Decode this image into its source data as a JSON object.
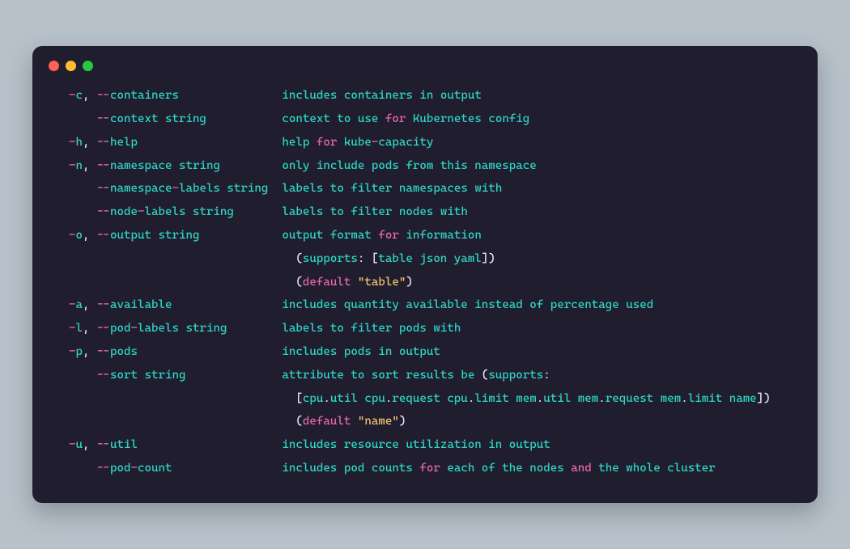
{
  "colors": {
    "bg_page": "#b7c1ca",
    "bg_terminal": "#1f1d2e",
    "token_teal": "#2fd6c4",
    "token_white": "#e6e3f3",
    "token_pink": "#e867a8",
    "token_yellow": "#f0c36d"
  },
  "traffic_lights": [
    "close",
    "minimize",
    "zoom"
  ],
  "lines": [
    [
      {
        "c": "teal",
        "t": "  "
      },
      {
        "c": "pink",
        "t": "-"
      },
      {
        "c": "teal",
        "t": "c"
      },
      {
        "c": "white",
        "t": ", "
      },
      {
        "c": "pink",
        "t": "--"
      },
      {
        "c": "teal",
        "t": "containers"
      },
      {
        "c": "teal",
        "t": "               includes"
      },
      {
        "c": "teal",
        "t": " containers"
      },
      {
        "c": "teal",
        "t": " in"
      },
      {
        "c": "teal",
        "t": " output"
      }
    ],
    [
      {
        "c": "teal",
        "t": "      "
      },
      {
        "c": "pink",
        "t": "--"
      },
      {
        "c": "teal",
        "t": "context string"
      },
      {
        "c": "teal",
        "t": "           context"
      },
      {
        "c": "teal",
        "t": " to"
      },
      {
        "c": "teal",
        "t": " use "
      },
      {
        "c": "pink",
        "t": "for"
      },
      {
        "c": "teal",
        "t": " Kubernetes"
      },
      {
        "c": "teal",
        "t": " config"
      }
    ],
    [
      {
        "c": "teal",
        "t": "  "
      },
      {
        "c": "pink",
        "t": "-"
      },
      {
        "c": "teal",
        "t": "h"
      },
      {
        "c": "white",
        "t": ", "
      },
      {
        "c": "pink",
        "t": "--"
      },
      {
        "c": "teal",
        "t": "help"
      },
      {
        "c": "teal",
        "t": "                     help "
      },
      {
        "c": "pink",
        "t": "for"
      },
      {
        "c": "teal",
        "t": " kube"
      },
      {
        "c": "pink",
        "t": "-"
      },
      {
        "c": "teal",
        "t": "capacity"
      }
    ],
    [
      {
        "c": "teal",
        "t": "  "
      },
      {
        "c": "pink",
        "t": "-"
      },
      {
        "c": "teal",
        "t": "n"
      },
      {
        "c": "white",
        "t": ", "
      },
      {
        "c": "pink",
        "t": "--"
      },
      {
        "c": "teal",
        "t": "namespace string"
      },
      {
        "c": "teal",
        "t": "         only"
      },
      {
        "c": "teal",
        "t": " include"
      },
      {
        "c": "teal",
        "t": " pods"
      },
      {
        "c": "teal",
        "t": " from"
      },
      {
        "c": "teal",
        "t": " this"
      },
      {
        "c": "teal",
        "t": " namespace"
      }
    ],
    [
      {
        "c": "teal",
        "t": "      "
      },
      {
        "c": "pink",
        "t": "--"
      },
      {
        "c": "teal",
        "t": "namespace"
      },
      {
        "c": "pink",
        "t": "-"
      },
      {
        "c": "teal",
        "t": "labels string"
      },
      {
        "c": "teal",
        "t": "  labels"
      },
      {
        "c": "teal",
        "t": " to"
      },
      {
        "c": "teal",
        "t": " filter"
      },
      {
        "c": "teal",
        "t": " namespaces"
      },
      {
        "c": "teal",
        "t": " with"
      }
    ],
    [
      {
        "c": "teal",
        "t": "      "
      },
      {
        "c": "pink",
        "t": "--"
      },
      {
        "c": "teal",
        "t": "node"
      },
      {
        "c": "pink",
        "t": "-"
      },
      {
        "c": "teal",
        "t": "labels string"
      },
      {
        "c": "teal",
        "t": "       labels"
      },
      {
        "c": "teal",
        "t": " to"
      },
      {
        "c": "teal",
        "t": " filter"
      },
      {
        "c": "teal",
        "t": " nodes"
      },
      {
        "c": "teal",
        "t": " with"
      }
    ],
    [
      {
        "c": "teal",
        "t": "  "
      },
      {
        "c": "pink",
        "t": "-"
      },
      {
        "c": "teal",
        "t": "o"
      },
      {
        "c": "white",
        "t": ", "
      },
      {
        "c": "pink",
        "t": "--"
      },
      {
        "c": "teal",
        "t": "output string"
      },
      {
        "c": "teal",
        "t": "            output"
      },
      {
        "c": "teal",
        "t": " format "
      },
      {
        "c": "pink",
        "t": "for"
      },
      {
        "c": "teal",
        "t": " information"
      }
    ],
    [
      {
        "c": "teal",
        "t": "                                   "
      },
      {
        "c": "white",
        "t": "("
      },
      {
        "c": "teal",
        "t": "supports"
      },
      {
        "c": "white",
        "t": ": ["
      },
      {
        "c": "teal",
        "t": "table json yaml"
      },
      {
        "c": "white",
        "t": "])"
      }
    ],
    [
      {
        "c": "teal",
        "t": "                                   "
      },
      {
        "c": "white",
        "t": "("
      },
      {
        "c": "pink",
        "t": "default"
      },
      {
        "c": "teal",
        "t": " "
      },
      {
        "c": "yellow",
        "t": "\"table\""
      },
      {
        "c": "white",
        "t": ")"
      }
    ],
    [
      {
        "c": "teal",
        "t": "  "
      },
      {
        "c": "pink",
        "t": "-"
      },
      {
        "c": "teal",
        "t": "a"
      },
      {
        "c": "white",
        "t": ", "
      },
      {
        "c": "pink",
        "t": "--"
      },
      {
        "c": "teal",
        "t": "available"
      },
      {
        "c": "teal",
        "t": "                includes"
      },
      {
        "c": "teal",
        "t": " quantity"
      },
      {
        "c": "teal",
        "t": " available"
      },
      {
        "c": "teal",
        "t": " instead"
      },
      {
        "c": "teal",
        "t": " of"
      },
      {
        "c": "teal",
        "t": " percentage"
      },
      {
        "c": "teal",
        "t": " used"
      }
    ],
    [
      {
        "c": "teal",
        "t": "  "
      },
      {
        "c": "pink",
        "t": "-"
      },
      {
        "c": "teal",
        "t": "l"
      },
      {
        "c": "white",
        "t": ", "
      },
      {
        "c": "pink",
        "t": "--"
      },
      {
        "c": "teal",
        "t": "pod"
      },
      {
        "c": "pink",
        "t": "-"
      },
      {
        "c": "teal",
        "t": "labels string"
      },
      {
        "c": "teal",
        "t": "        labels"
      },
      {
        "c": "teal",
        "t": " to"
      },
      {
        "c": "teal",
        "t": " filter"
      },
      {
        "c": "teal",
        "t": " pods"
      },
      {
        "c": "teal",
        "t": " with"
      }
    ],
    [
      {
        "c": "teal",
        "t": "  "
      },
      {
        "c": "pink",
        "t": "-"
      },
      {
        "c": "teal",
        "t": "p"
      },
      {
        "c": "white",
        "t": ", "
      },
      {
        "c": "pink",
        "t": "--"
      },
      {
        "c": "teal",
        "t": "pods"
      },
      {
        "c": "teal",
        "t": "                     includes"
      },
      {
        "c": "teal",
        "t": " pods"
      },
      {
        "c": "teal",
        "t": " in"
      },
      {
        "c": "teal",
        "t": " output"
      }
    ],
    [
      {
        "c": "teal",
        "t": "      "
      },
      {
        "c": "pink",
        "t": "--"
      },
      {
        "c": "teal",
        "t": "sort string"
      },
      {
        "c": "teal",
        "t": "              attribute"
      },
      {
        "c": "teal",
        "t": " to"
      },
      {
        "c": "teal",
        "t": " sort"
      },
      {
        "c": "teal",
        "t": " results"
      },
      {
        "c": "teal",
        "t": " be "
      },
      {
        "c": "white",
        "t": "("
      },
      {
        "c": "teal",
        "t": "supports"
      },
      {
        "c": "white",
        "t": ":"
      }
    ],
    [
      {
        "c": "teal",
        "t": "                                   "
      },
      {
        "c": "white",
        "t": "["
      },
      {
        "c": "teal",
        "t": "cpu"
      },
      {
        "c": "white",
        "t": "."
      },
      {
        "c": "teal",
        "t": "util cpu"
      },
      {
        "c": "white",
        "t": "."
      },
      {
        "c": "teal",
        "t": "request cpu"
      },
      {
        "c": "white",
        "t": "."
      },
      {
        "c": "teal",
        "t": "limit mem"
      },
      {
        "c": "white",
        "t": "."
      },
      {
        "c": "teal",
        "t": "util mem"
      },
      {
        "c": "white",
        "t": "."
      },
      {
        "c": "teal",
        "t": "request mem"
      },
      {
        "c": "white",
        "t": "."
      },
      {
        "c": "teal",
        "t": "limit name"
      },
      {
        "c": "white",
        "t": "])"
      }
    ],
    [
      {
        "c": "teal",
        "t": "                                   "
      },
      {
        "c": "white",
        "t": "("
      },
      {
        "c": "pink",
        "t": "default"
      },
      {
        "c": "teal",
        "t": " "
      },
      {
        "c": "yellow",
        "t": "\"name\""
      },
      {
        "c": "white",
        "t": ")"
      }
    ],
    [
      {
        "c": "teal",
        "t": "  "
      },
      {
        "c": "pink",
        "t": "-"
      },
      {
        "c": "teal",
        "t": "u"
      },
      {
        "c": "white",
        "t": ", "
      },
      {
        "c": "pink",
        "t": "--"
      },
      {
        "c": "teal",
        "t": "util"
      },
      {
        "c": "teal",
        "t": "                     includes"
      },
      {
        "c": "teal",
        "t": " resource"
      },
      {
        "c": "teal",
        "t": " utilization"
      },
      {
        "c": "teal",
        "t": " in"
      },
      {
        "c": "teal",
        "t": " output"
      }
    ],
    [
      {
        "c": "teal",
        "t": "      "
      },
      {
        "c": "pink",
        "t": "--"
      },
      {
        "c": "teal",
        "t": "pod"
      },
      {
        "c": "pink",
        "t": "-"
      },
      {
        "c": "teal",
        "t": "count"
      },
      {
        "c": "teal",
        "t": "                includes"
      },
      {
        "c": "teal",
        "t": " pod"
      },
      {
        "c": "teal",
        "t": " counts "
      },
      {
        "c": "pink",
        "t": "for"
      },
      {
        "c": "teal",
        "t": " each"
      },
      {
        "c": "teal",
        "t": " of"
      },
      {
        "c": "teal",
        "t": " the"
      },
      {
        "c": "teal",
        "t": " nodes "
      },
      {
        "c": "pink",
        "t": "and"
      },
      {
        "c": "teal",
        "t": " the"
      },
      {
        "c": "teal",
        "t": " whole"
      },
      {
        "c": "teal",
        "t": " cluster"
      }
    ]
  ]
}
